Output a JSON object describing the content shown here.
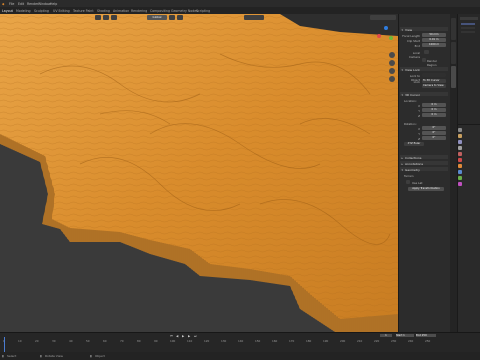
{
  "app": {
    "accent": "#e38a2a",
    "menu": [
      "File",
      "Edit",
      "Render",
      "Window",
      "Help"
    ],
    "workspace_tabs": [
      "Layout",
      "Modeling",
      "Sculpting",
      "UV Editing",
      "Texture Paint",
      "Shading",
      "Animation",
      "Rendering",
      "Compositing",
      "Geometry Nodes",
      "Scripting"
    ]
  },
  "viewport": {
    "header": {
      "mode_label": "Object Mode",
      "view_label": "View",
      "select_label": "Select",
      "add_label": "Add",
      "object_label": "Object",
      "transform_label": "Global"
    },
    "terrain_color": "#e59a3a"
  },
  "npanel": {
    "tabs": [
      "Item",
      "Tool",
      "View"
    ],
    "view_section": {
      "title": "View",
      "focal_label": "Focal Length",
      "focal_value": "50 mm",
      "clip_start_label": "Clip Start",
      "clip_start_value": "0.01 m",
      "clip_end_label": "End",
      "clip_end_value": "1000 m",
      "local_camera_label": "Local Camera",
      "render_region_label": "Render Region"
    },
    "view_lock": {
      "title": "View Lock",
      "lock_object_label": "Lock to Object",
      "lock_label": "Lock",
      "to_3d_cursor": "To 3D Cursor",
      "camera_to_view": "Camera to View"
    },
    "cursor_section": {
      "title": "3D Cursor",
      "location_label": "Location:",
      "x_label": "X",
      "x_value": "0 m",
      "y_label": "Y",
      "y_value": "0 m",
      "z_label": "Z",
      "z_value": "0 m",
      "rotation_label": "Rotation:",
      "rx_value": "0°",
      "ry_value": "0°",
      "rz_value": "0°",
      "mode_value": "XYZ Euler"
    },
    "collapsed": [
      "Collections",
      "Annotations"
    ],
    "geometry_section": {
      "title": "Geometry",
      "subtitle": "Terrain",
      "option": "Use Lat",
      "button": "Apply Transformation"
    }
  },
  "timeline": {
    "frame_current": "1",
    "start_label": "Start",
    "start_value": "1",
    "end_label": "End",
    "end_value": "250",
    "ruler": [
      "0",
      "10",
      "20",
      "30",
      "40",
      "50",
      "60",
      "70",
      "80",
      "90",
      "100",
      "110",
      "120",
      "130",
      "140",
      "150",
      "160",
      "170",
      "180",
      "190",
      "200",
      "210",
      "220",
      "230",
      "240",
      "250"
    ]
  },
  "statusbar": {
    "left": "Select",
    "middle": "Rotate View",
    "right": "Object"
  }
}
